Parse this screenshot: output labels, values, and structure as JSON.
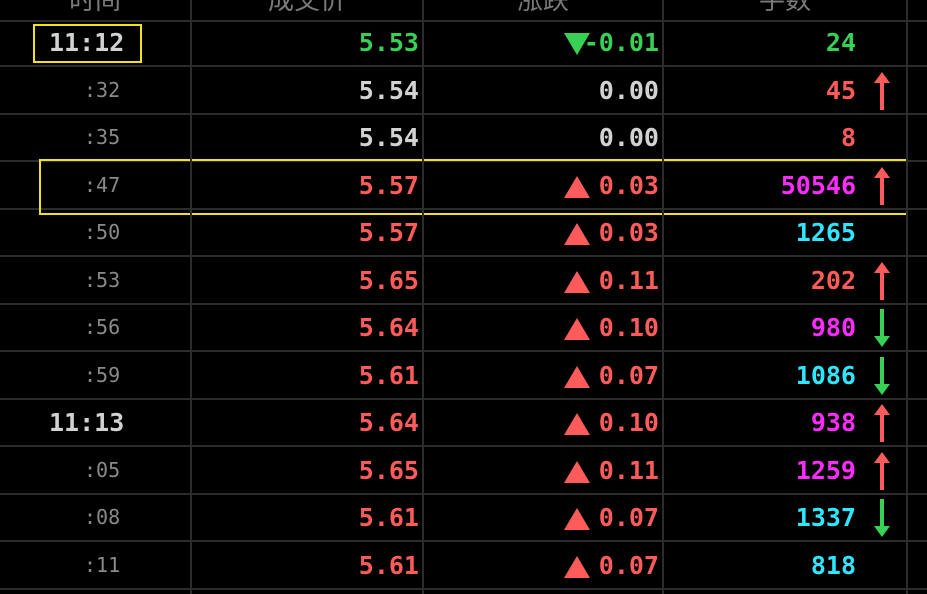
{
  "colors": {
    "up": "#ff5b5b",
    "down": "#37d156",
    "flat": "#d2d2d2",
    "vol_red": "#ff5b5b",
    "vol_green": "#37d156",
    "vol_magenta": "#ff2cff",
    "vol_cyan": "#2ee7ff",
    "grid": "#2c2c2c",
    "highlight": "#f2e21c"
  },
  "header": {
    "time": "时间",
    "price": "成交价",
    "change": "涨跌",
    "volume": "手数"
  },
  "rows": [
    {
      "time": "11:12",
      "time_style": "big",
      "price": "5.53",
      "price_color": "down",
      "change": "-0.01",
      "dir": "down",
      "volume": "24",
      "vol_color": "vol_green",
      "arrow": "none",
      "highlight_time": true
    },
    {
      "time": ":32",
      "time_style": "small",
      "price": "5.54",
      "price_color": "flat",
      "change": "0.00",
      "dir": "flat",
      "volume": "45",
      "vol_color": "vol_red",
      "arrow": "up"
    },
    {
      "time": ":35",
      "time_style": "small",
      "price": "5.54",
      "price_color": "flat",
      "change": "0.00",
      "dir": "flat",
      "volume": "8",
      "vol_color": "vol_red",
      "arrow": "none"
    },
    {
      "time": ":47",
      "time_style": "small",
      "price": "5.57",
      "price_color": "up",
      "change": "0.03",
      "dir": "up",
      "volume": "50546",
      "vol_color": "vol_magenta",
      "arrow": "up",
      "highlight_row": true
    },
    {
      "time": ":50",
      "time_style": "small",
      "price": "5.57",
      "price_color": "up",
      "change": "0.03",
      "dir": "up",
      "volume": "1265",
      "vol_color": "vol_cyan",
      "arrow": "none"
    },
    {
      "time": ":53",
      "time_style": "small",
      "price": "5.65",
      "price_color": "up",
      "change": "0.11",
      "dir": "up",
      "volume": "202",
      "vol_color": "vol_red",
      "arrow": "up"
    },
    {
      "time": ":56",
      "time_style": "small",
      "price": "5.64",
      "price_color": "up",
      "change": "0.10",
      "dir": "up",
      "volume": "980",
      "vol_color": "vol_magenta",
      "arrow": "down"
    },
    {
      "time": ":59",
      "time_style": "small",
      "price": "5.61",
      "price_color": "up",
      "change": "0.07",
      "dir": "up",
      "volume": "1086",
      "vol_color": "vol_cyan",
      "arrow": "down"
    },
    {
      "time": "11:13",
      "time_style": "big",
      "price": "5.64",
      "price_color": "up",
      "change": "0.10",
      "dir": "up",
      "volume": "938",
      "vol_color": "vol_magenta",
      "arrow": "up"
    },
    {
      "time": ":05",
      "time_style": "small",
      "price": "5.65",
      "price_color": "up",
      "change": "0.11",
      "dir": "up",
      "volume": "1259",
      "vol_color": "vol_magenta",
      "arrow": "up"
    },
    {
      "time": ":08",
      "time_style": "small",
      "price": "5.61",
      "price_color": "up",
      "change": "0.07",
      "dir": "up",
      "volume": "1337",
      "vol_color": "vol_cyan",
      "arrow": "down"
    },
    {
      "time": ":11",
      "time_style": "small",
      "price": "5.61",
      "price_color": "up",
      "change": "0.07",
      "dir": "up",
      "volume": "818",
      "vol_color": "vol_cyan",
      "arrow": "none"
    }
  ]
}
